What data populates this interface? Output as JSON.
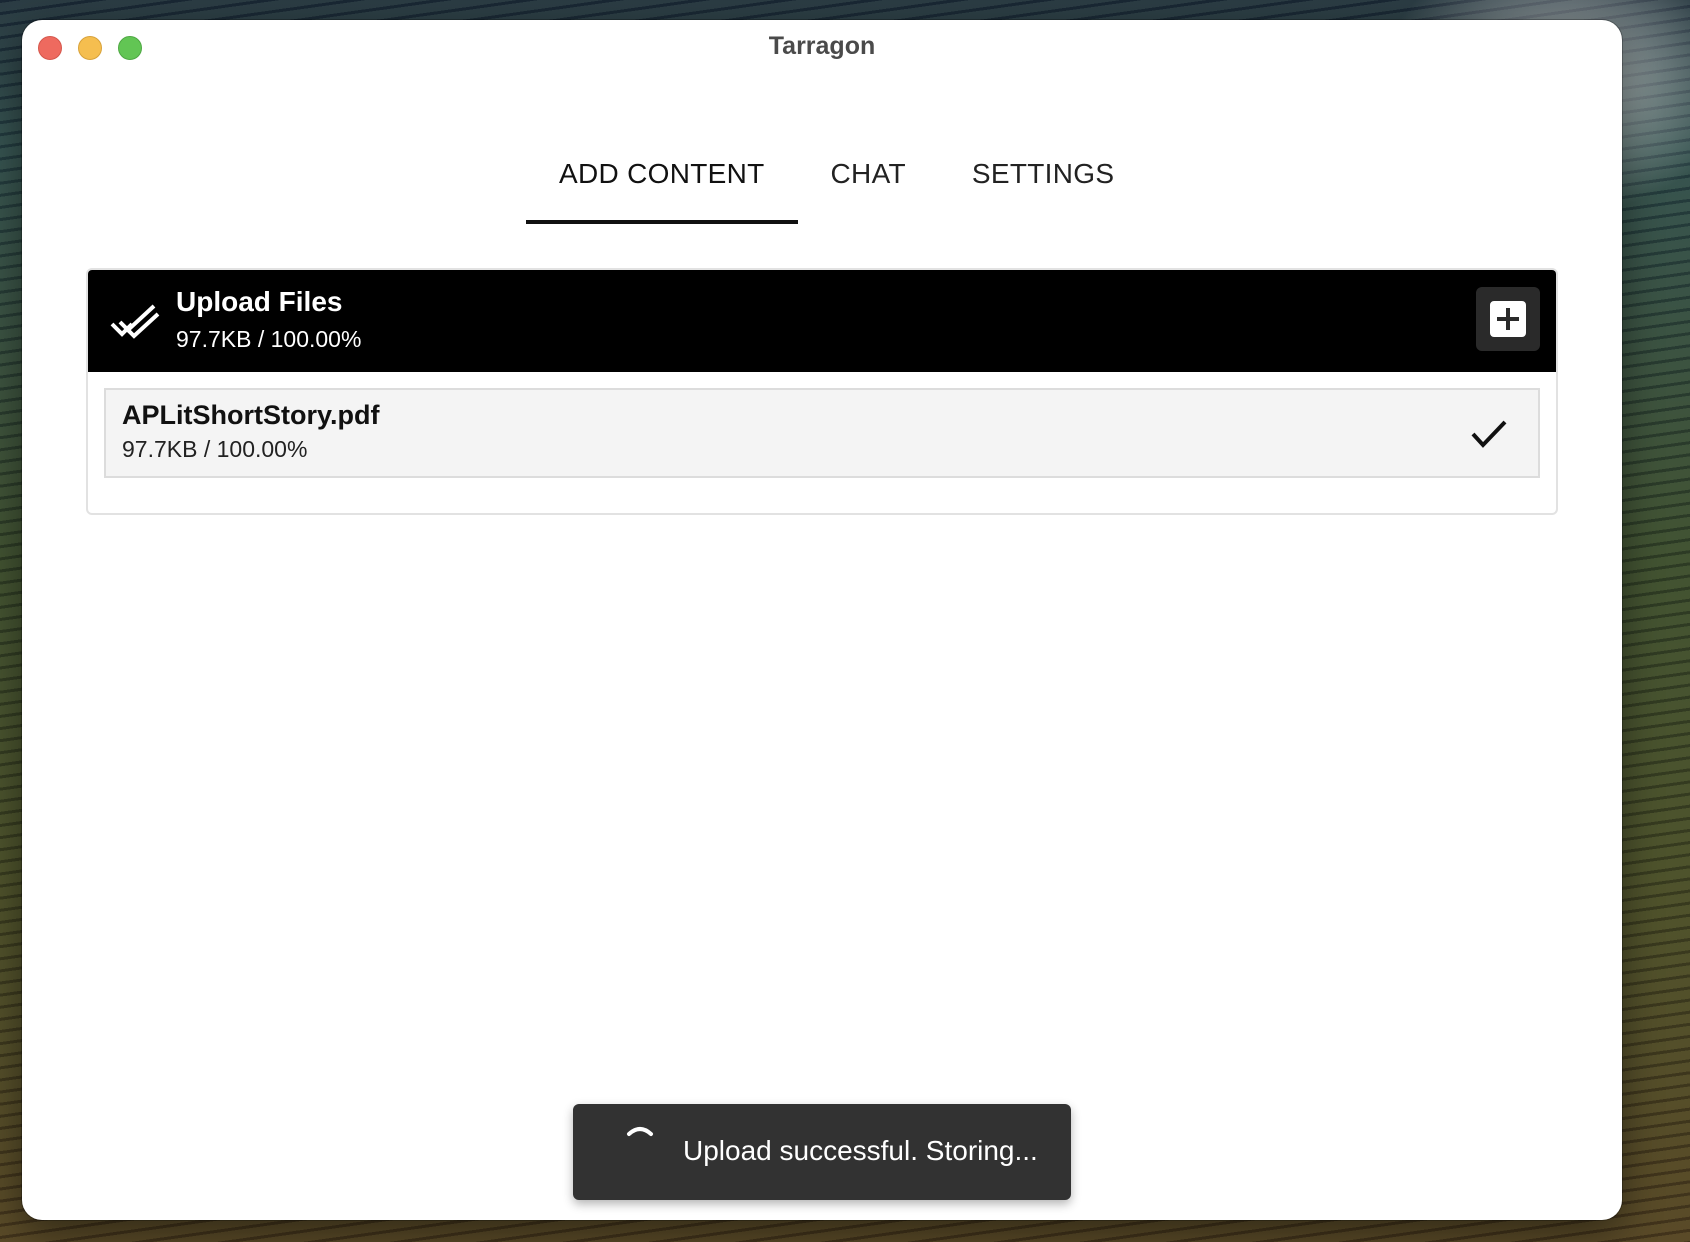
{
  "window": {
    "title": "Tarragon",
    "controls": [
      "close",
      "minimize",
      "maximize"
    ]
  },
  "tabs": [
    {
      "label": "ADD CONTENT",
      "active": true
    },
    {
      "label": "CHAT",
      "active": false
    },
    {
      "label": "SETTINGS",
      "active": false
    }
  ],
  "upload": {
    "header_title": "Upload Files",
    "header_status": "97.7KB / 100.00%",
    "status_icon": "done-all-icon",
    "add_icon": "plus-icon",
    "files": [
      {
        "name": "APLitShortStory.pdf",
        "status": "97.7KB / 100.00%",
        "icon": "check-icon"
      }
    ]
  },
  "toast": {
    "message": "Upload successful. Storing...",
    "icon": "spinner-icon"
  },
  "colors": {
    "header_bg": "#000000",
    "row_bg": "#f4f4f4",
    "toast_bg": "#323232",
    "close": "#ee6a5f",
    "minimize": "#f5be4f",
    "maximize": "#62c554"
  }
}
